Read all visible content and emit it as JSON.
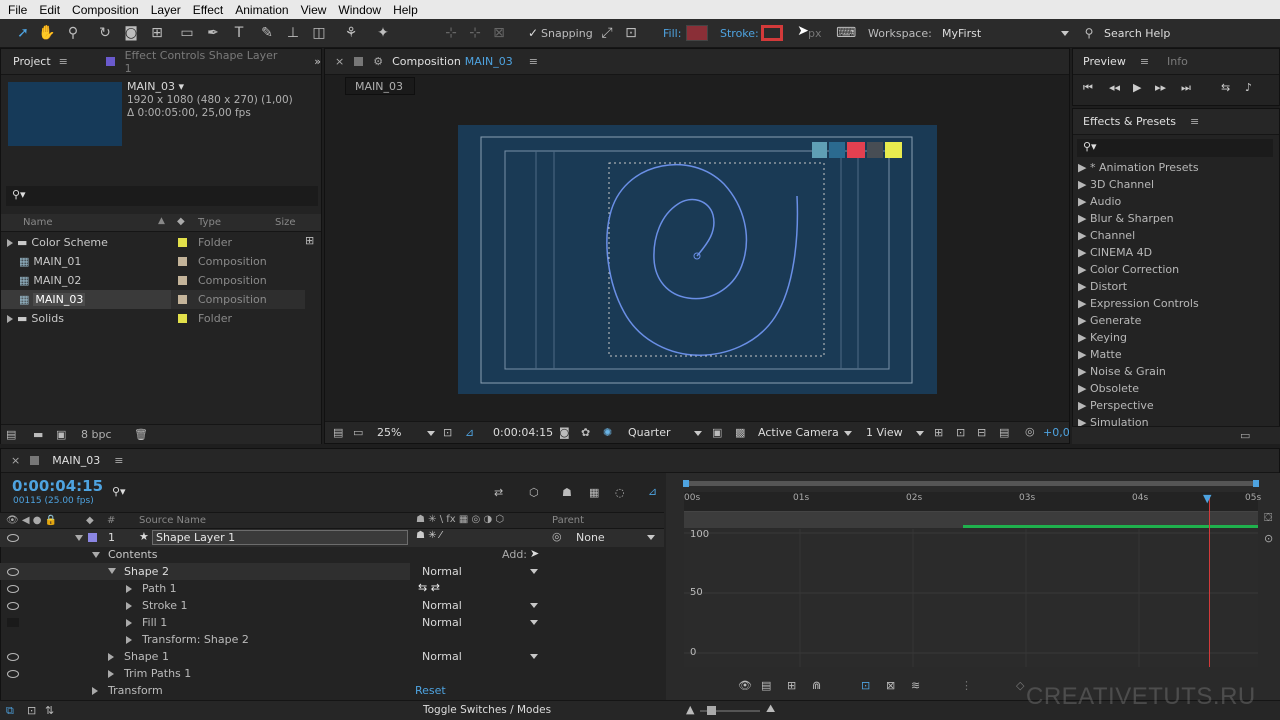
{
  "menu": [
    "File",
    "Edit",
    "Composition",
    "Layer",
    "Effect",
    "Animation",
    "View",
    "Window",
    "Help"
  ],
  "toolbar": {
    "snapping_label": "Snapping",
    "fill_label": "Fill:",
    "stroke_label": "Stroke:",
    "stroke_px": "px",
    "workspace_label": "Workspace:",
    "workspace_value": "MyFirst",
    "search_help": "Search Help"
  },
  "project": {
    "tab_label": "Project",
    "effect_controls_label": "Effect Controls Shape Layer 1",
    "selected_name": "MAIN_03",
    "selected_dims": "1920 x 1080  (480 x 270) (1,00)",
    "selected_duration": "Δ 0:00:05:00, 25,00 fps",
    "search_placeholder": "",
    "columns": {
      "name": "Name",
      "type": "Type",
      "size": "Size"
    },
    "items": [
      {
        "name": "Color Scheme",
        "type": "Folder",
        "kind": "folder"
      },
      {
        "name": "MAIN_01",
        "type": "Composition",
        "kind": "comp"
      },
      {
        "name": "MAIN_02",
        "type": "Composition",
        "kind": "comp"
      },
      {
        "name": "MAIN_03",
        "type": "Composition",
        "kind": "comp",
        "selected": true
      },
      {
        "name": "Solids",
        "type": "Folder",
        "kind": "folder"
      }
    ],
    "bpc": "8 bpc"
  },
  "composition": {
    "tab_label": "Composition",
    "tab_comp": "MAIN_03",
    "comp_tab": "MAIN_03",
    "zoom": "25%",
    "timecode": "0:00:04:15",
    "resolution": "Quarter",
    "camera": "Active Camera",
    "views": "1 View",
    "exposure": "+0,0"
  },
  "preview": {
    "tab_label": "Preview",
    "info_label": "Info"
  },
  "effects": {
    "tab_label": "Effects & Presets",
    "items": [
      "* Animation Presets",
      "3D Channel",
      "Audio",
      "Blur & Sharpen",
      "Channel",
      "CINEMA 4D",
      "Color Correction",
      "Distort",
      "Expression Controls",
      "Generate",
      "Keying",
      "Matte",
      "Noise & Grain",
      "Obsolete",
      "Perspective",
      "Simulation"
    ]
  },
  "timeline": {
    "tab_label": "MAIN_03",
    "timecode": "0:00:04:15",
    "frame_info": "00115 (25.00 fps)",
    "source_name_header": "Source Name",
    "parent_header": "Parent",
    "hash_header": "#",
    "layer_number": "1",
    "layer_name": "Shape Layer 1",
    "parent_value": "None",
    "contents_label": "Contents",
    "add_label": "Add:",
    "reset_label": "Reset",
    "toggle_label": "Toggle Switches / Modes",
    "ruler": [
      "00s",
      "01s",
      "02s",
      "03s",
      "04s",
      "05s"
    ],
    "graph_labels": [
      "100",
      "50",
      "0"
    ],
    "props": [
      {
        "label": "Shape 2",
        "mode": "Normal"
      },
      {
        "label": "Path 1",
        "mode": ""
      },
      {
        "label": "Stroke 1",
        "mode": "Normal"
      },
      {
        "label": "Fill 1",
        "mode": "Normal"
      },
      {
        "label": "Transform: Shape 2",
        "mode": ""
      },
      {
        "label": "Shape 1",
        "mode": "Normal"
      },
      {
        "label": "Trim Paths 1",
        "mode": ""
      },
      {
        "label": "Transform",
        "mode": ""
      }
    ]
  },
  "watermark": "CREATIVETUTS.RU",
  "colors": {
    "accent": "#4ea3e0",
    "comp_bg": "#1a3a55",
    "spiral": "#6a8fe6",
    "work_area": "#1fb14d",
    "playhead": "#d33a3a"
  }
}
